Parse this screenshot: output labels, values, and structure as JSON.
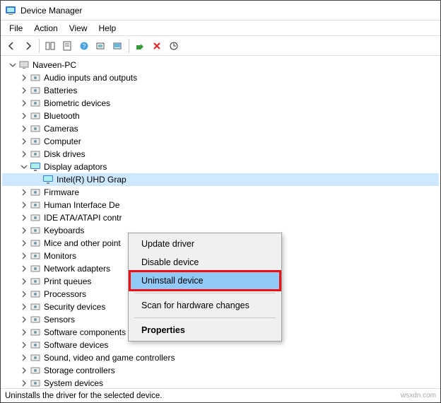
{
  "window": {
    "title": "Device Manager"
  },
  "menu": {
    "file": "File",
    "action": "Action",
    "view": "View",
    "help": "Help"
  },
  "toolbar_icons": {
    "back": "back-arrow",
    "forward": "forward-arrow",
    "show_hide": "show-hide",
    "properties": "properties",
    "help": "help",
    "scan": "scan",
    "monitor": "monitor",
    "enable": "enable",
    "disable": "disable",
    "update": "update"
  },
  "root": {
    "label": "Naveen-PC"
  },
  "categories": [
    {
      "label": "Audio inputs and outputs",
      "expanded": false
    },
    {
      "label": "Batteries",
      "expanded": false
    },
    {
      "label": "Biometric devices",
      "expanded": false
    },
    {
      "label": "Bluetooth",
      "expanded": false
    },
    {
      "label": "Cameras",
      "expanded": false
    },
    {
      "label": "Computer",
      "expanded": false
    },
    {
      "label": "Disk drives",
      "expanded": false
    },
    {
      "label": "Display adaptors",
      "expanded": true,
      "child": "Intel(R) UHD Grap"
    },
    {
      "label": "Firmware",
      "expanded": false
    },
    {
      "label": "Human Interface De",
      "expanded": false
    },
    {
      "label": "IDE ATA/ATAPI contr",
      "expanded": false
    },
    {
      "label": "Keyboards",
      "expanded": false
    },
    {
      "label": "Mice and other point",
      "expanded": false
    },
    {
      "label": "Monitors",
      "expanded": false
    },
    {
      "label": "Network adapters",
      "expanded": false
    },
    {
      "label": "Print queues",
      "expanded": false
    },
    {
      "label": "Processors",
      "expanded": false
    },
    {
      "label": "Security devices",
      "expanded": false
    },
    {
      "label": "Sensors",
      "expanded": false
    },
    {
      "label": "Software components",
      "expanded": false
    },
    {
      "label": "Software devices",
      "expanded": false
    },
    {
      "label": "Sound, video and game controllers",
      "expanded": false
    },
    {
      "label": "Storage controllers",
      "expanded": false
    },
    {
      "label": "System devices",
      "expanded": false
    }
  ],
  "context_menu": {
    "update": "Update driver",
    "disable": "Disable device",
    "uninstall": "Uninstall device",
    "scan": "Scan for hardware changes",
    "properties": "Properties"
  },
  "status": {
    "text": "Uninstalls the driver for the selected device."
  },
  "watermark": "wsxdn.com"
}
